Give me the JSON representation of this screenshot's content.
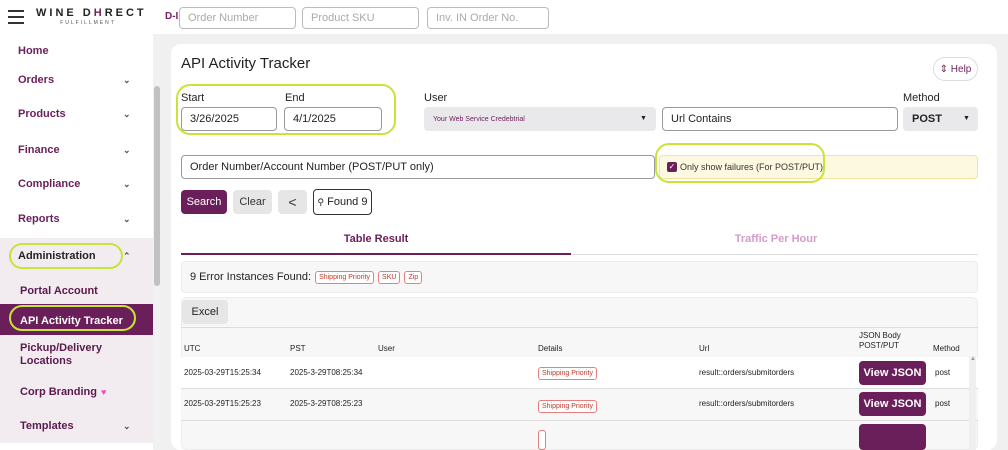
{
  "brand": {
    "logo_left": "WINE D",
    "logo_accent": "H",
    "logo_right": "RECT",
    "logo_sub": "FULFILLMENT",
    "brand_color": "#6b1f5a",
    "highlight_color": "#c6e43a"
  },
  "topbar": {
    "order_number_placeholder": "Order Number",
    "product_sku_placeholder": "Product SKU",
    "inv_placeholder": "Inv. IN Order No.",
    "dh_icon": "D-I"
  },
  "sidebar": {
    "items": [
      {
        "label": "Home",
        "chevron": ""
      },
      {
        "label": "Orders",
        "chevron": "⌄"
      },
      {
        "label": "Products",
        "chevron": "⌄"
      },
      {
        "label": "Finance",
        "chevron": "⌄"
      },
      {
        "label": "Compliance",
        "chevron": "⌄"
      },
      {
        "label": "Reports",
        "chevron": "⌄"
      },
      {
        "label": "Administration",
        "chevron": "⌃"
      }
    ],
    "sub_items": [
      {
        "label": "Portal Account"
      },
      {
        "label": "API Activity Tracker"
      },
      {
        "label": "Pickup/Delivery Locations"
      },
      {
        "label": "Corp Branding",
        "badge": "heart-icon"
      },
      {
        "label": "Templates",
        "chevron": "⌄"
      }
    ]
  },
  "page": {
    "title": "API Activity Tracker",
    "help": "⇕ Help"
  },
  "filters": {
    "start_label": "Start",
    "start_value": "3/26/2025",
    "end_label": "End",
    "end_value": "4/1/2025",
    "user_label": "User",
    "user_value": "Your Web Service Credebtrial",
    "url_placeholder": "Url Contains",
    "method_label": "Method",
    "method_value": "POST",
    "order_placeholder": "Order Number/Account Number (POST/PUT only)",
    "failures_label": "Only show failures (For POST/PUT)",
    "failures_checked": true
  },
  "actions": {
    "search": "Search",
    "clear": "Clear",
    "found": "Found 9"
  },
  "tabs": [
    {
      "label": "Table Result",
      "active": true
    },
    {
      "label": "Traffic Per Hour",
      "active": false
    }
  ],
  "errors": {
    "text": "9 Error Instances Found:",
    "badges": [
      "Shipping Priority",
      "SKU",
      "Zip"
    ]
  },
  "table": {
    "excel": "Excel",
    "headers": {
      "utc": "UTC",
      "pst": "PST",
      "user": "User",
      "details": "Details",
      "url": "Url",
      "json1": "JSON Body",
      "json2": "POST/PUT",
      "method": "Method"
    },
    "rows": [
      {
        "utc": "2025-03-29T15:25:34",
        "pst": "2025-3-29T08:25:34",
        "user": "",
        "details": "Shipping Priority",
        "url": "result::orders/submitorders",
        "action": "View JSON",
        "method": "post"
      },
      {
        "utc": "2025-03-29T15:25:23",
        "pst": "2025-3-29T08:25:23",
        "user": "",
        "details": "Shipping Priority",
        "url": "result::orders/submitorders",
        "action": "View JSON",
        "method": "post"
      }
    ]
  }
}
